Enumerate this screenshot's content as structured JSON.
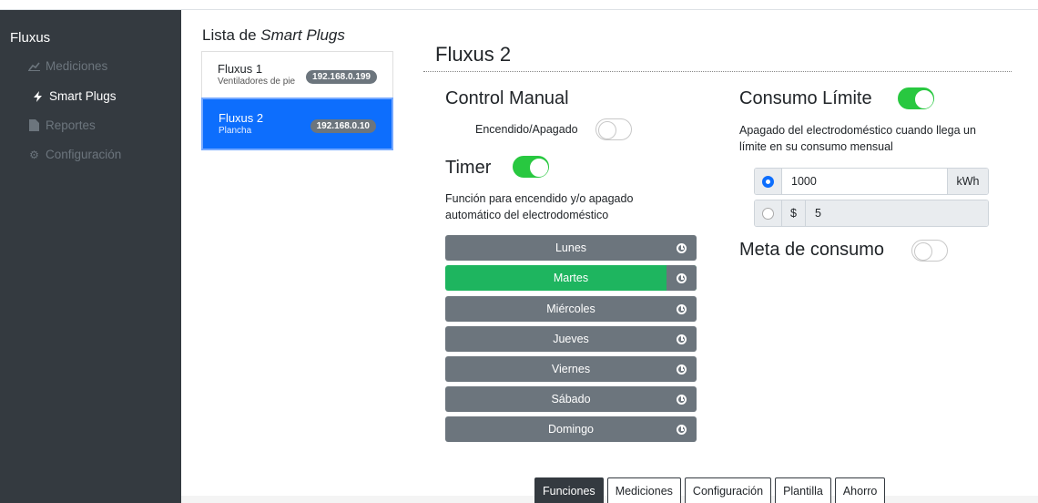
{
  "sidebar": {
    "brand": "Fluxus",
    "items": [
      {
        "label": "Mediciones",
        "icon": "chart-line-icon"
      },
      {
        "label": "Smart Plugs",
        "icon": "bolt-icon"
      },
      {
        "label": "Reportes",
        "icon": "file-icon"
      },
      {
        "label": "Configuración",
        "icon": "gear-icon"
      }
    ]
  },
  "plug_list": {
    "title_prefix": "Lista de ",
    "title_emph": "Smart Plugs",
    "items": [
      {
        "name": "Fluxus 1",
        "sub": "Ventiladores de pie",
        "ip": "192.168.0.199"
      },
      {
        "name": "Fluxus 2",
        "sub": "Plancha",
        "ip": "192.168.0.10"
      }
    ]
  },
  "main": {
    "title": "Fluxus 2",
    "control_manual": {
      "title": "Control Manual",
      "toggle_label": "Encendido/Apagado",
      "on": false
    },
    "timer": {
      "title": "Timer",
      "on": true,
      "description_line1": "Función para encendido y/o apagado",
      "description_line2": "automático del electrodoméstico",
      "days": [
        "Lunes",
        "Martes",
        "Miércoles",
        "Jueves",
        "Viernes",
        "Sábado",
        "Domingo"
      ],
      "active_day": "Martes"
    },
    "consumo_limite": {
      "title": "Consumo Límite",
      "on": true,
      "description_line1": "Apagado del electrodoméstico cuando llega un",
      "description_line2": "límite en su consumo mensual",
      "kwh_value": "1000",
      "kwh_unit": "kWh",
      "money_prefix": "$",
      "money_value": "5"
    },
    "meta_consumo": {
      "title": "Meta de consumo",
      "on": false
    }
  },
  "tabs": [
    "Funciones",
    "Mediciones",
    "Configuración",
    "Plantilla",
    "Ahorro"
  ],
  "active_tab": "Funciones",
  "colors": {
    "accent": "#0d6efd",
    "success": "#28c840",
    "sidebar": "#343a40",
    "day_active": "#1eb55f"
  }
}
